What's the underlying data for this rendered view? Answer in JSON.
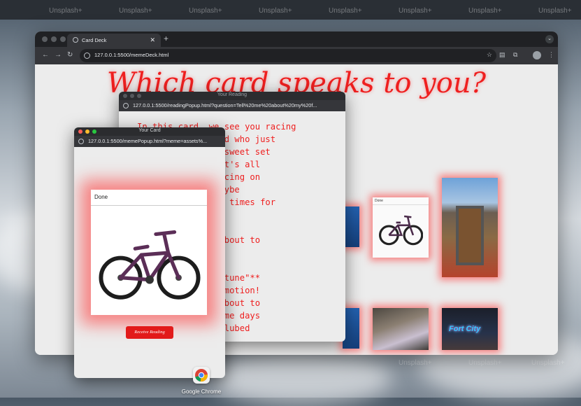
{
  "desktop": {
    "watermark": "Unsplash+",
    "dock_app_label": "Google Chrome"
  },
  "main_window": {
    "tab_title": "Card Deck",
    "url": "127.0.0.1:5500/memeDeck.html",
    "heading": "Which card speaks to you?"
  },
  "reading_popup": {
    "title": "Your Reading",
    "url": "127.0.0.1:5500/readingPopup.html?question=Tell%20me%20about%20my%20f...",
    "text": "In this card, we see you racing\n        like a kid who just\n        om and a sweet set\n        future? It's all\n        ks, balancing on\n        y, and maybe\n        ees a few times for\n        epare for\n        cents and\n        -life's about to\n        cle!\n\n        el of Fortune\"**\n        heels in motion!\n         you're about to\n        nches. Some days\n          a well-lubed"
  },
  "card_popup": {
    "title": "Your Card",
    "url": "127.0.0.1:5500/memePopup.html?meme=assets%...",
    "card_label": "Done",
    "button_label": "Receive Reading"
  },
  "deck_cards": {
    "bike_label": "Done",
    "fort_text": "Fort City"
  },
  "colors": {
    "accent": "#ef1f1f",
    "button": "#e21a1a",
    "chrome_dark": "#202124",
    "chrome_toolbar": "#35363a"
  }
}
